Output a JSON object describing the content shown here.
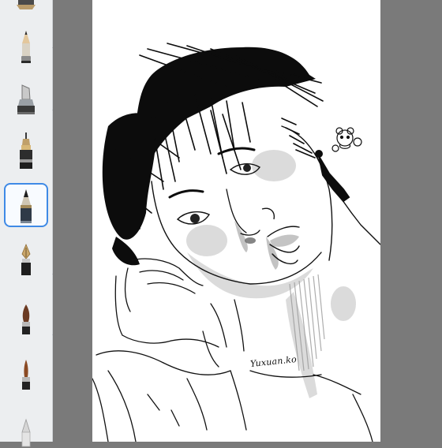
{
  "app": {
    "accent_color": "#3f8ae6",
    "toolbar_background": "#eceef0",
    "workspace_background": "#7a7a7a",
    "canvas_background": "#ffffff"
  },
  "toolbar": {
    "tools": [
      {
        "id": "brush-partial",
        "icon": "round-brush-icon",
        "selected": false
      },
      {
        "id": "pencil",
        "icon": "pencil-icon",
        "selected": false
      },
      {
        "id": "chisel-marker",
        "icon": "chisel-marker-icon",
        "selected": false
      },
      {
        "id": "technical-pen",
        "icon": "technical-pen-icon",
        "selected": false
      },
      {
        "id": "ballpoint-pen",
        "icon": "ballpoint-pen-icon",
        "selected": true
      },
      {
        "id": "fountain-pen",
        "icon": "fountain-pen-icon",
        "selected": false
      },
      {
        "id": "paint-brush",
        "icon": "paint-brush-icon",
        "selected": false
      },
      {
        "id": "fine-brush",
        "icon": "fine-brush-icon",
        "selected": false
      },
      {
        "id": "airbrush",
        "icon": "airbrush-icon",
        "selected": false
      }
    ]
  },
  "canvas": {
    "signature": "Yuxuan.ko"
  }
}
